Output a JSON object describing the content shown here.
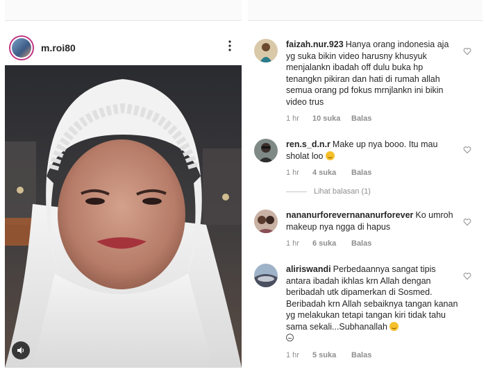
{
  "post": {
    "username": "m.roi80",
    "more_icon": "more-vertical-icon",
    "audio_icon": "speaker-icon"
  },
  "comments": [
    {
      "username": "faizah.nur.923",
      "text": "Hanya orang indonesia aja yg suka bikin video harusny khusyuk menjalankn ibadah off dulu buka hp tenangkn pikiran dan hati di rumah allah semua orang pd fokus mrnjlankn ini bikin video trus",
      "time": "1 hr",
      "likes": "10 suka",
      "reply": "Balas"
    },
    {
      "username": "ren.s_d.n.r",
      "text": "Make up nya booo. Itu mau sholat loo",
      "emoji": "grinning-emoji",
      "time": "1 hr",
      "likes": "4 suka",
      "reply": "Balas"
    },
    {
      "username": "nananurforevernananurforever",
      "text": "Ko umroh makeup nya ngga di hapus",
      "time": "1 hr",
      "likes": "6 suka",
      "reply": "Balas"
    },
    {
      "username": "aliriswandi",
      "text": "Perbedaannya sangat tipis antara ibadah ikhlas krn Allah dengan beribadah utk dipamerkan di Sosmed. Beribadah krn Allah sebaiknya tangan kanan yg melakukan tetapi tangan kiri tidak tahu sama sekali...Subhanallah",
      "emoji": "unamused-emoji",
      "time": "1 hr",
      "likes": "5 suka",
      "reply": "Balas"
    }
  ],
  "view_replies": "Lihat balasan (1)",
  "colors": {
    "text": "#262626",
    "meta": "#8e8e8e",
    "story_ring": "#c13584"
  }
}
